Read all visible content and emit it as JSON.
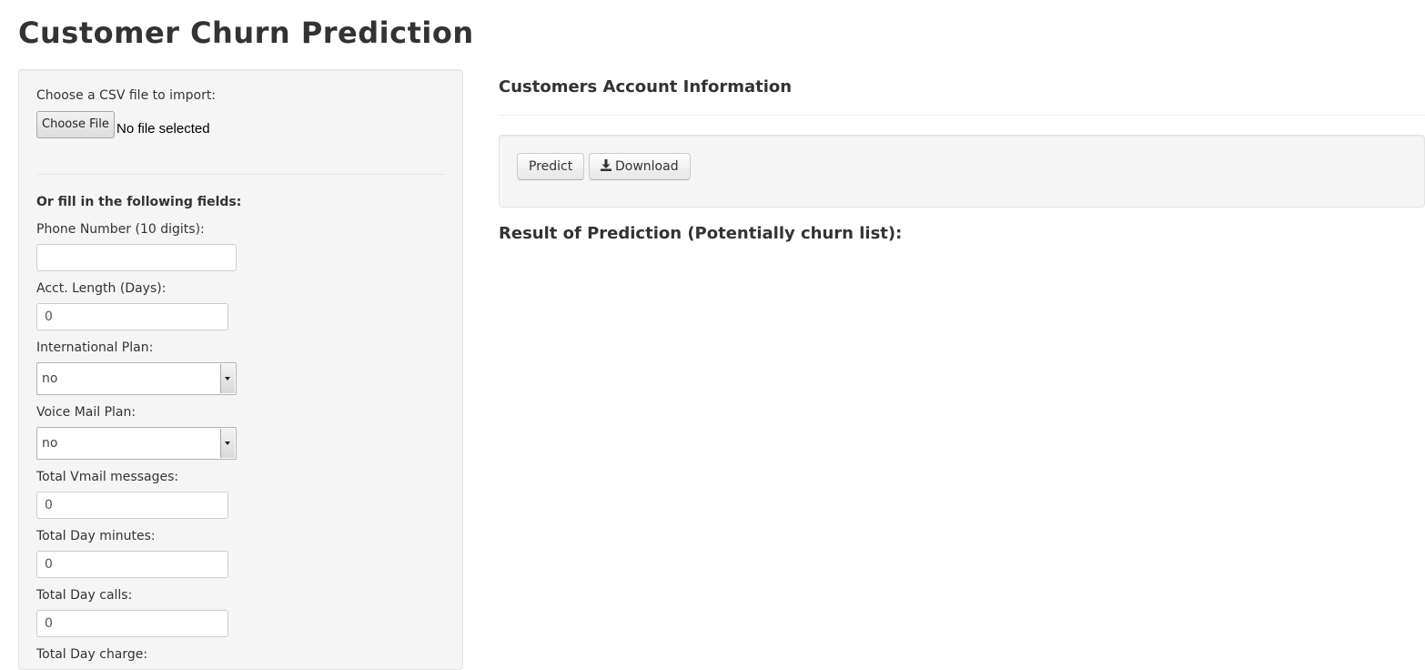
{
  "page": {
    "title": "Customer Churn Prediction"
  },
  "sidebar": {
    "csv_label": "Choose a CSV file to import:",
    "file_button": "Choose File",
    "file_status": "No file selected",
    "or_fill_label": "Or fill in the following fields:",
    "fields": {
      "phone": {
        "label": "Phone Number (10 digits):",
        "value": ""
      },
      "acct_length": {
        "label": "Acct. Length (Days):",
        "value": "0"
      },
      "intl_plan": {
        "label": "International Plan:",
        "value": "no"
      },
      "vmail_plan": {
        "label": "Voice Mail Plan:",
        "value": "no"
      },
      "vmail_msgs": {
        "label": "Total Vmail messages:",
        "value": "0"
      },
      "day_minutes": {
        "label": "Total Day minutes:",
        "value": "0"
      },
      "day_calls": {
        "label": "Total Day calls:",
        "value": "0"
      },
      "day_charge": {
        "label": "Total Day charge:"
      }
    }
  },
  "main": {
    "heading": "Customers Account Information",
    "predict_button": "Predict",
    "download_button": "Download",
    "download_icon": "download-icon",
    "result_heading": "Result of Prediction (Potentially churn list):"
  }
}
